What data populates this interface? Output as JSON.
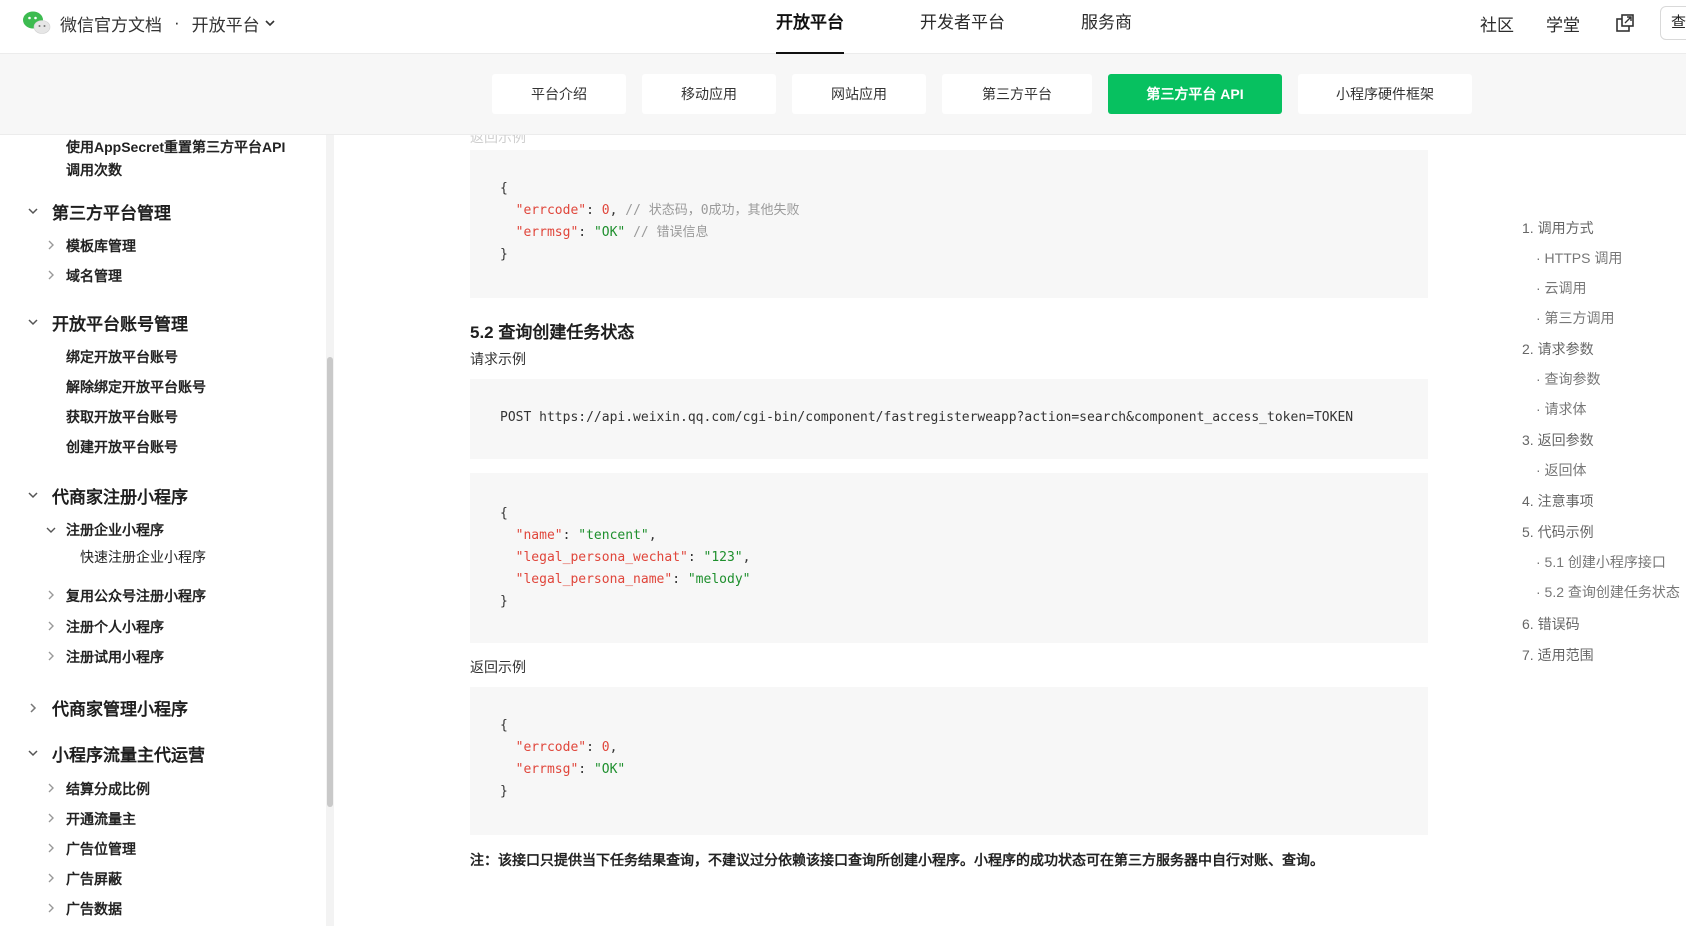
{
  "header": {
    "brand_title": "微信官方文档",
    "brand_dot": "·",
    "brand_sub": "开放平台",
    "nav": [
      "开放平台",
      "开发者平台",
      "服务商"
    ],
    "nav_active_index": 0,
    "right": [
      "社区",
      "学堂"
    ],
    "search_label": "查"
  },
  "subtabs": [
    {
      "label": "平台介绍",
      "active": false
    },
    {
      "label": "移动应用",
      "active": false
    },
    {
      "label": "网站应用",
      "active": false
    },
    {
      "label": "第三方平台",
      "active": false
    },
    {
      "label": "第三方平台 API",
      "active": true
    },
    {
      "label": "小程序硬件框架",
      "active": false
    }
  ],
  "sidebar": {
    "items": [
      {
        "label": "使用AppSecret重置第三方平台API",
        "level": "l2",
        "chevron": "none"
      },
      {
        "label": "调用次数",
        "level": "l2",
        "chevron": "none"
      },
      {
        "label": "第三方平台管理",
        "level": "l1",
        "chevron": "down"
      },
      {
        "label": "模板库管理",
        "level": "l2",
        "chevron": "right"
      },
      {
        "label": "域名管理",
        "level": "l2",
        "chevron": "right"
      },
      {
        "label": "开放平台账号管理",
        "level": "l1",
        "chevron": "down"
      },
      {
        "label": "绑定开放平台账号",
        "level": "l2",
        "chevron": "none"
      },
      {
        "label": "解除绑定开放平台账号",
        "level": "l2",
        "chevron": "none"
      },
      {
        "label": "获取开放平台账号",
        "level": "l2",
        "chevron": "none"
      },
      {
        "label": "创建开放平台账号",
        "level": "l2",
        "chevron": "none"
      },
      {
        "label": "代商家注册小程序",
        "level": "l1",
        "chevron": "down"
      },
      {
        "label": "注册企业小程序",
        "level": "l2",
        "chevron": "down"
      },
      {
        "label": "快速注册企业小程序",
        "level": "l3",
        "chevron": "none"
      },
      {
        "label": "复用公众号注册小程序",
        "level": "l2",
        "chevron": "right"
      },
      {
        "label": "注册个人小程序",
        "level": "l2",
        "chevron": "right"
      },
      {
        "label": "注册试用小程序",
        "level": "l2",
        "chevron": "right"
      },
      {
        "label": "代商家管理小程序",
        "level": "l1",
        "chevron": "right"
      },
      {
        "label": "小程序流量主代运营",
        "level": "l1",
        "chevron": "down"
      },
      {
        "label": "结算分成比例",
        "level": "l2",
        "chevron": "right"
      },
      {
        "label": "开通流量主",
        "level": "l2",
        "chevron": "right"
      },
      {
        "label": "广告位管理",
        "level": "l2",
        "chevron": "right"
      },
      {
        "label": "广告屏蔽",
        "level": "l2",
        "chevron": "right"
      },
      {
        "label": "广告数据",
        "level": "l2",
        "chevron": "right"
      }
    ]
  },
  "content": {
    "faded_label": "返回示例",
    "code1": {
      "open": "{",
      "l1_key": "\"errcode\"",
      "l1_sep": ": ",
      "l1_val": "0",
      "l1_tail": ", ",
      "l1_comment": "// 状态码，0成功，其他失败",
      "l2_key": "\"errmsg\"",
      "l2_sep": ": ",
      "l2_val": "\"OK\"",
      "l2_tail": " ",
      "l2_comment": "// 错误信息",
      "close": "}"
    },
    "heading": "5.2 查询创建任务状态",
    "request_label": "请求示例",
    "request_line": "POST https://api.weixin.qq.com/cgi-bin/component/fastregisterweapp?action=search&component_access_token=TOKEN",
    "code2": {
      "open": "{",
      "l1_key": "\"name\"",
      "l1_val": "\"tencent\"",
      "l1_tail": ",",
      "l2_key": "\"legal_persona_wechat\"",
      "l2_val": "\"123\"",
      "l2_tail": ",",
      "l3_key": "\"legal_persona_name\"",
      "l3_val": "\"melody\"",
      "l3_tail": "",
      "sep": ": ",
      "close": "}"
    },
    "response_label": "返回示例",
    "code3": {
      "open": "{",
      "l1_key": "\"errcode\"",
      "l1_val": "0",
      "l1_tail": ",",
      "l2_key": "\"errmsg\"",
      "l2_val": "\"OK\"",
      "sep": ": ",
      "close": "}"
    },
    "note": "注：该接口只提供当下任务结果查询，不建议过分依赖该接口查询所创建小程序。小程序的成功状态可在第三方服务器中自行对账、查询。"
  },
  "toc": {
    "items": [
      {
        "label": "1. 调用方式",
        "sub": false
      },
      {
        "label": "· HTTPS 调用",
        "sub": true
      },
      {
        "label": "· 云调用",
        "sub": true
      },
      {
        "label": "· 第三方调用",
        "sub": true
      },
      {
        "label": "2. 请求参数",
        "sub": false
      },
      {
        "label": "· 查询参数",
        "sub": true
      },
      {
        "label": "· 请求体",
        "sub": true
      },
      {
        "label": "3. 返回参数",
        "sub": false
      },
      {
        "label": "· 返回体",
        "sub": true
      },
      {
        "label": "4. 注意事项",
        "sub": false
      },
      {
        "label": "5. 代码示例",
        "sub": false
      },
      {
        "label": "· 5.1 创建小程序接口",
        "sub": true
      },
      {
        "label": "· 5.2 查询创建任务状态",
        "sub": true
      },
      {
        "label": "6. 错误码",
        "sub": false
      },
      {
        "label": "7. 适用范围",
        "sub": false
      }
    ]
  },
  "colors": {
    "accent_green": "#07c160",
    "code_key": "#e0463b",
    "code_string": "#1e8f2d",
    "code_comment": "#9a9a9a"
  }
}
